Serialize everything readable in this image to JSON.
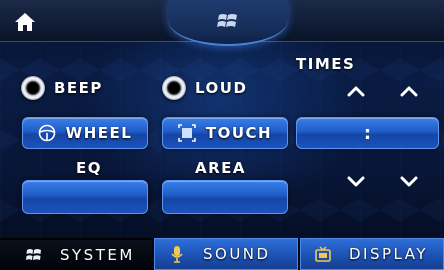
{
  "topbar": {
    "home_icon": "home-icon",
    "center_icon": "windows-logo-icon"
  },
  "settings": {
    "beep_label": "BEEP",
    "loud_label": "LOUD",
    "times_label": "TIMES",
    "wheel_label": "WHEEL",
    "touch_label": "TOUCH",
    "time_separator": ":",
    "eq_label": "EQ",
    "area_label": "AREA",
    "eq_value": "",
    "area_value": ""
  },
  "tabs": [
    {
      "label": "SYSTEM",
      "icon": "windows-logo-icon",
      "active": true
    },
    {
      "label": "SOUND",
      "icon": "microphone-icon",
      "active": false
    },
    {
      "label": "DISPLAY",
      "icon": "display-icon",
      "active": false
    }
  ],
  "colors": {
    "accent": "#2f6fe0",
    "active_tab": "#000308",
    "text": "#ffffff"
  }
}
